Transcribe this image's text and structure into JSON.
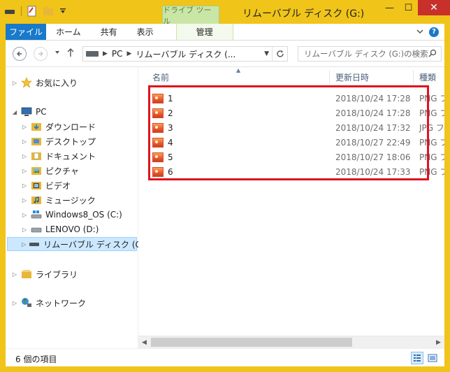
{
  "window": {
    "title": "リムーバブル ディスク (G:)",
    "context_tab_group": "ドライブ ツール",
    "caption": {
      "minimize": "—",
      "maximize": "☐",
      "close": "✕"
    }
  },
  "ribbon": {
    "tabs": [
      "ファイル",
      "ホーム",
      "共有",
      "表示"
    ],
    "context_tab": "管理",
    "expand_icon": "chevron-down-icon",
    "help_label": "?"
  },
  "address": {
    "crumbs": [
      "PC",
      "リムーバブル ディスク (..."
    ],
    "search_placeholder": "リムーバブル ディスク (G:)の検索"
  },
  "navigation": {
    "items": [
      {
        "label": "お気に入り",
        "icon": "star-icon"
      },
      {
        "label": "PC",
        "icon": "computer-icon"
      },
      {
        "label": "ダウンロード",
        "icon": "downloads-folder-icon"
      },
      {
        "label": "デスクトップ",
        "icon": "desktop-folder-icon"
      },
      {
        "label": "ドキュメント",
        "icon": "documents-folder-icon"
      },
      {
        "label": "ピクチャ",
        "icon": "pictures-folder-icon"
      },
      {
        "label": "ビデオ",
        "icon": "videos-folder-icon"
      },
      {
        "label": "ミュージック",
        "icon": "music-folder-icon"
      },
      {
        "label": "Windows8_OS (C:)",
        "icon": "windows-drive-icon"
      },
      {
        "label": "LENOVO (D:)",
        "icon": "drive-icon"
      },
      {
        "label": "リムーバブル ディスク (G:)",
        "icon": "removable-drive-icon"
      },
      {
        "label": "ライブラリ",
        "icon": "libraries-icon"
      },
      {
        "label": "ネットワーク",
        "icon": "network-icon"
      }
    ],
    "selected": "リムーバブル ディスク (G:)"
  },
  "files": {
    "columns": {
      "name": "名前",
      "date": "更新日時",
      "type": "種類"
    },
    "rows": [
      {
        "name": "1",
        "date": "2018/10/24 17:28",
        "type": "PNG ファ"
      },
      {
        "name": "2",
        "date": "2018/10/24 17:28",
        "type": "PNG ファ"
      },
      {
        "name": "3",
        "date": "2018/10/24 17:32",
        "type": "JPG ファ"
      },
      {
        "name": "4",
        "date": "2018/10/27 22:49",
        "type": "PNG ファ"
      },
      {
        "name": "5",
        "date": "2018/10/27 18:06",
        "type": "PNG ファ"
      },
      {
        "name": "6",
        "date": "2018/10/24 17:33",
        "type": "PNG ファ"
      }
    ]
  },
  "status": {
    "item_count": "6 個の項目"
  },
  "colors": {
    "accent": "#1979ca",
    "frame": "#f0c419",
    "highlight": "#e0141e",
    "selection": "#cce8ff"
  }
}
